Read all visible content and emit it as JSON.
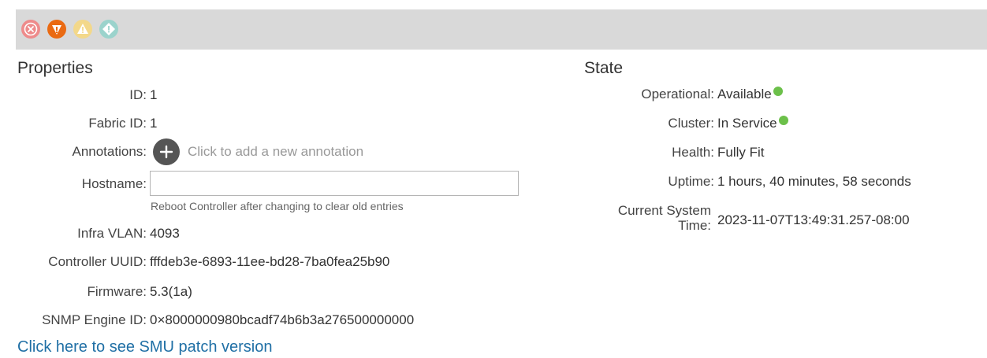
{
  "fault_icons": [
    {
      "name": "critical",
      "icon": "close-circle-icon",
      "color": "#ee8b8b"
    },
    {
      "name": "major",
      "icon": "warning-shield-icon",
      "color": "#ea6a12"
    },
    {
      "name": "minor",
      "icon": "warning-triangle-icon",
      "color": "#f3d88a"
    },
    {
      "name": "warning",
      "icon": "exclamation-circle-icon",
      "color": "#9bd3cc"
    }
  ],
  "properties": {
    "title": "Properties",
    "id": {
      "label": "ID:",
      "value": "1"
    },
    "fabric_id": {
      "label": "Fabric ID:",
      "value": "1"
    },
    "annotations": {
      "label": "Annotations:",
      "hint": "Click to add a new annotation"
    },
    "hostname": {
      "label": "Hostname:",
      "value": "",
      "placeholder": "",
      "hint": "Reboot Controller after changing to clear old entries"
    },
    "infra_vlan": {
      "label": "Infra VLAN:",
      "value": "4093"
    },
    "controller_uuid": {
      "label": "Controller UUID:",
      "value": "fffdeb3e-6893-11ee-bd28-7ba0fea25b90"
    },
    "firmware": {
      "label": "Firmware:",
      "value": "5.3(1a)"
    },
    "snmp_engine_id": {
      "label": "SNMP Engine ID:",
      "value": "0×8000000980bcadf74b6b3a276500000000"
    }
  },
  "state": {
    "title": "State",
    "operational": {
      "label": "Operational:",
      "value": "Available"
    },
    "cluster": {
      "label": "Cluster:",
      "value": "In Service"
    },
    "health": {
      "label": "Health:",
      "value": "Fully Fit"
    },
    "uptime": {
      "label": "Uptime:",
      "value": "1 hours, 40 minutes, 58 seconds"
    },
    "current_system_time": {
      "label_line1": "Current System",
      "label_line2": "Time:",
      "value": "2023-11-07T13:49:31.257-08:00"
    }
  },
  "smu_link": "Click here to see SMU patch version",
  "colors": {
    "status_green": "#6cc04a",
    "link_blue": "#1f6fa5",
    "toolbar_bg": "#d9d9d9"
  }
}
